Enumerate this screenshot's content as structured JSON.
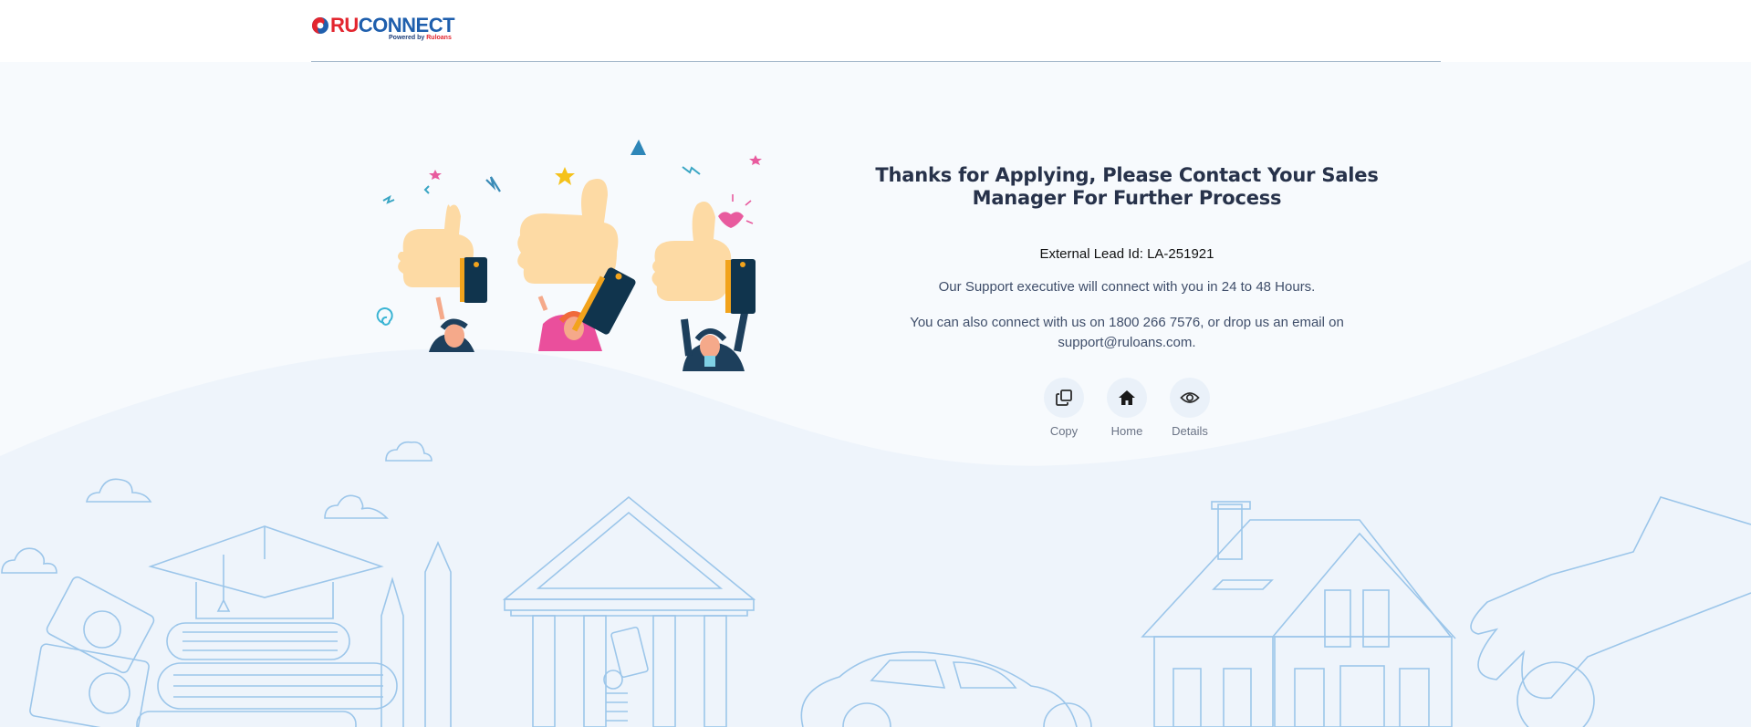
{
  "brand": {
    "name_primary": "RU",
    "name_secondary": "CONNECT",
    "tagline_prefix": "Powered by ",
    "tagline_brand": "Ruloans",
    "colors": {
      "red": "#e3262f",
      "blue": "#1f5fad"
    }
  },
  "message": {
    "title": "Thanks for Applying, Please Contact Your Sales Manager For Further Process",
    "lead_id": "External Lead Id: LA-251921",
    "support": "Our Support executive will connect with you in 24 to 48 Hours.",
    "contact": "You can also connect with us on 1800 266 7576, or drop us an email on support@ruloans.com."
  },
  "actions": [
    {
      "label": "Copy",
      "icon": "copy-icon"
    },
    {
      "label": "Home",
      "icon": "home-icon"
    },
    {
      "label": "Details",
      "icon": "eye-icon"
    }
  ],
  "theme": {
    "accent": "#eaf1f9",
    "illustration_line": "#9cc6ea"
  }
}
